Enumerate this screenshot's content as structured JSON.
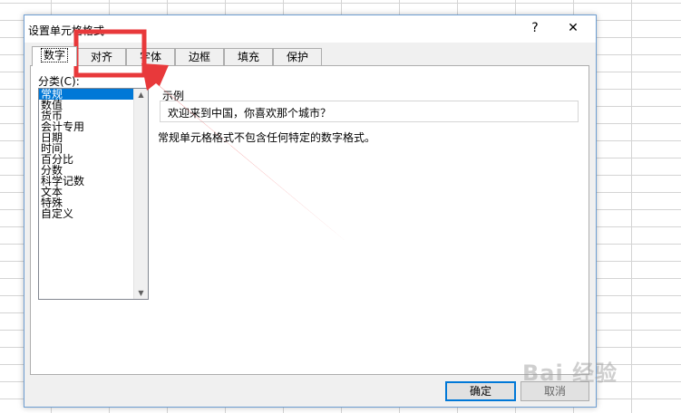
{
  "dialog": {
    "title": "设置单元格格式",
    "help": "?",
    "close": "✕"
  },
  "tabs": [
    {
      "label": "数字",
      "active": true
    },
    {
      "label": "对齐"
    },
    {
      "label": "字体"
    },
    {
      "label": "边框"
    },
    {
      "label": "填充"
    },
    {
      "label": "保护"
    }
  ],
  "category": {
    "label": "分类(C):",
    "items": [
      "常规",
      "数值",
      "货币",
      "会计专用",
      "日期",
      "时间",
      "百分比",
      "分数",
      "科学记数",
      "文本",
      "特殊",
      "自定义"
    ],
    "selected": "常规"
  },
  "sample": {
    "label": "示例",
    "text": "欢迎来到中国，你喜欢那个城市？"
  },
  "description": "常规单元格格式不包含任何特定的数字格式。",
  "buttons": {
    "ok": "确定",
    "cancel": "取消"
  },
  "watermark": "Bai 经验",
  "highlight_color": "#e8393b"
}
